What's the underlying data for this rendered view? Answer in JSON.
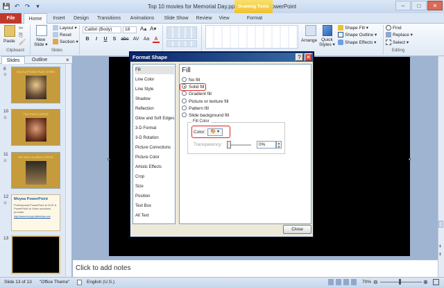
{
  "window": {
    "title": "Top 10 movies for Memorial Day.pptx - Microsoft PowerPoint",
    "context_tab": "Drawing Tools"
  },
  "qat": {
    "save": "💾",
    "undo": "↶",
    "redo": "↷",
    "more": "▾"
  },
  "window_controls": {
    "minimize": "–",
    "maximize": "□",
    "close": "✕"
  },
  "tabs": {
    "file": "File",
    "items": [
      "Home",
      "Insert",
      "Design",
      "Transitions",
      "Animations",
      "Slide Show",
      "Review",
      "View",
      "Format"
    ]
  },
  "ribbon": {
    "clipboard": {
      "paste": "Paste",
      "label": "Clipboard"
    },
    "slides": {
      "new_slide": "New\nSlide ▾",
      "layout": "Layout ▾",
      "reset": "Reset",
      "section": "Section ▾",
      "label": "Slides"
    },
    "font": {
      "name": "Calibri (Body)",
      "size": "18",
      "bold": "B",
      "italic": "I",
      "underline": "U",
      "strike": "S",
      "shadow": "abc",
      "spacing": "AV",
      "case": "Aa",
      "color": "A"
    },
    "drawing": {
      "arrange": "Arrange",
      "quick_styles": "Quick\nStyles ▾",
      "shape_fill": "Shape Fill ▾",
      "shape_outline": "Shape Outline ▾",
      "shape_effects": "Shape Effects ▾"
    },
    "editing": {
      "find": "Find",
      "replace": "Replace ▾",
      "select": "Select ▾",
      "label": "Editing"
    }
  },
  "left_pane": {
    "tabs": [
      "Slides",
      "Outline"
    ],
    "close": "×",
    "slides": [
      {
        "num": "8",
        "title": "Saving Private Ryan (1998)"
      },
      {
        "num": "10",
        "title": "The Patriot (2000)"
      },
      {
        "num": "11",
        "title": "We Were Soldiers (2002)"
      },
      {
        "num": "12",
        "title": "Moyea PowerPoint",
        "body": "Professional PowerPoint to DVD & PowerPoint to Video solutions provider.",
        "link": "http://www.dvd-ppt-slideshow.com"
      },
      {
        "num": "13",
        "title": ""
      }
    ]
  },
  "notes": {
    "placeholder": "Click to add notes"
  },
  "status": {
    "slide": "Slide 13 of 13",
    "theme": "\"Office Theme\"",
    "lang": "English (U.S.)",
    "zoom": "70%"
  },
  "dialog": {
    "title": "Format Shape",
    "help": "?",
    "close": "✕",
    "categories": [
      "Fill",
      "Line Color",
      "Line Style",
      "Shadow",
      "Reflection",
      "Glow and Soft Edges",
      "3-D Format",
      "3-D Rotation",
      "Picture Corrections",
      "Picture Color",
      "Artistic Effects",
      "Crop",
      "Size",
      "Position",
      "Text Box",
      "Alt Text"
    ],
    "selected_category": "Fill",
    "panel_heading": "Fill",
    "options": [
      "No fill",
      "Solid fill",
      "Gradient fill",
      "Picture or texture fill",
      "Pattern fill",
      "Slide background fill"
    ],
    "selected_option": "Solid fill",
    "fill_color_group": "Fill Color",
    "color_label": "Color:",
    "color_button": "🎨 ▾",
    "transparency_label": "Transparency:",
    "transparency_value": "0%",
    "close_button": "Close"
  }
}
